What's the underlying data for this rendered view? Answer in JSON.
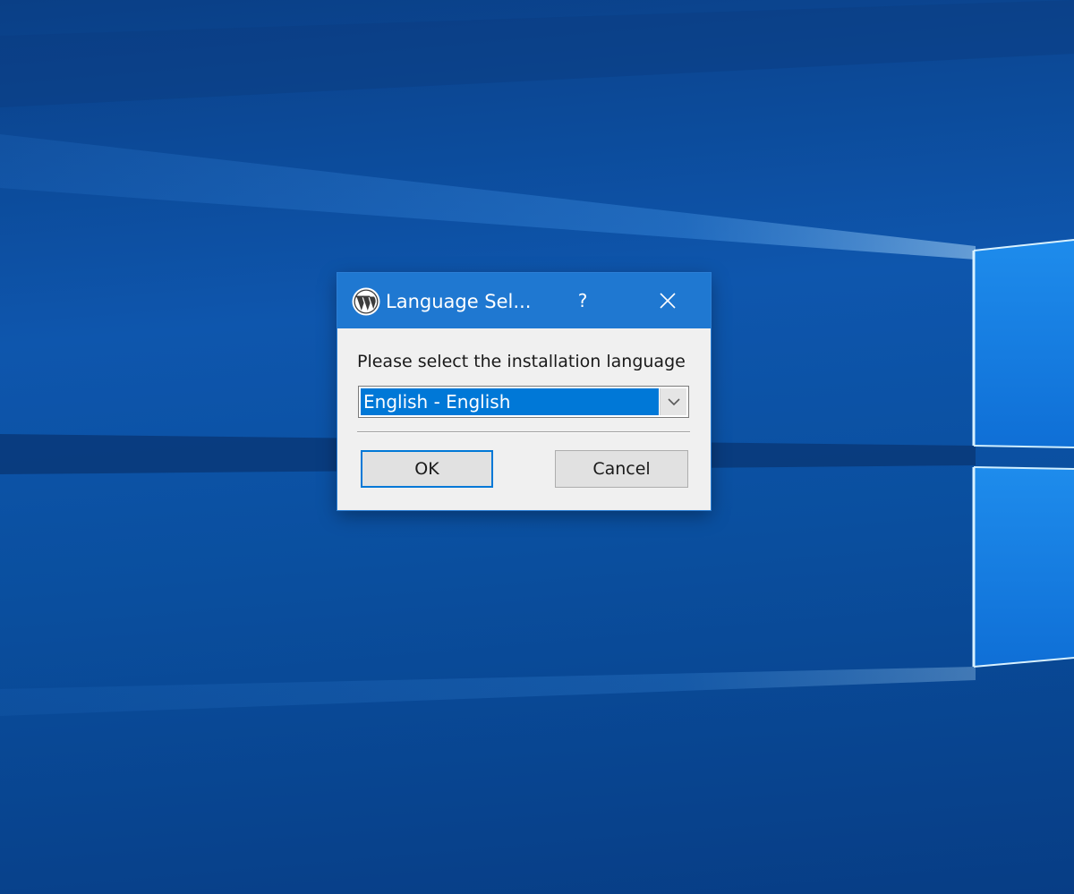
{
  "dialog": {
    "title": "Language Sel...",
    "help_label": "?",
    "prompt": "Please select the installation language",
    "language_select": {
      "selected_value": "English - English"
    },
    "ok_label": "OK",
    "cancel_label": "Cancel"
  },
  "icons": {
    "app": "wordpress-logo-icon",
    "close": "close-icon",
    "dropdown": "chevron-down-icon"
  },
  "colors": {
    "titlebar": "#1f78d1",
    "selection": "#0078d7",
    "dialog_bg": "#f0f0f0",
    "desktop": "#0e56ad"
  }
}
